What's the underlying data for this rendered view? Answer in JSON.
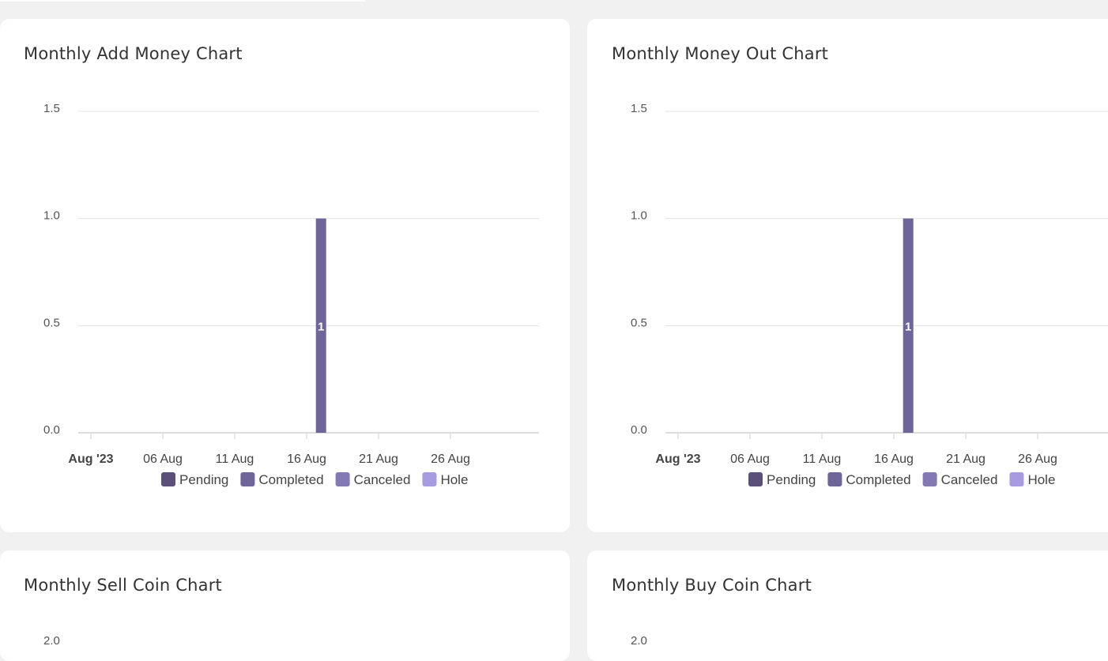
{
  "cards": [
    {
      "title": "Monthly Add Money Chart"
    },
    {
      "title": "Monthly Money Out Chart"
    },
    {
      "title": "Monthly Sell Coin Chart"
    },
    {
      "title": "Monthly Buy Coin Chart"
    }
  ],
  "legend": [
    {
      "label": "Pending",
      "color": "#5a5078"
    },
    {
      "label": "Completed",
      "color": "#6f6598"
    },
    {
      "label": "Canceled",
      "color": "#8579b4"
    },
    {
      "label": "Hole",
      "color": "#a99be0"
    }
  ],
  "chart_data": [
    {
      "type": "bar",
      "title": "Monthly Add Money Chart",
      "x_tick_labels": [
        "Aug '23",
        "06 Aug",
        "11 Aug",
        "16 Aug",
        "21 Aug",
        "26 Aug"
      ],
      "x_tick_dates": [
        "2023-08-01",
        "2023-08-06",
        "2023-08-11",
        "2023-08-16",
        "2023-08-21",
        "2023-08-26"
      ],
      "xlim": [
        "2023-08-01",
        "2023-08-31"
      ],
      "y_ticks": [
        "1.5",
        "1.0",
        "0.5",
        "0.0"
      ],
      "ylim": [
        0,
        1.5
      ],
      "stacked": true,
      "series": [
        {
          "name": "Pending",
          "points": []
        },
        {
          "name": "Completed",
          "points": [
            {
              "x": "2023-08-17",
              "y": 1,
              "label": "1"
            }
          ]
        },
        {
          "name": "Canceled",
          "points": []
        },
        {
          "name": "Hole",
          "points": []
        }
      ],
      "legend_position": "bottom",
      "grid": true
    },
    {
      "type": "bar",
      "title": "Monthly Money Out Chart",
      "x_tick_labels": [
        "Aug '23",
        "06 Aug",
        "11 Aug",
        "16 Aug",
        "21 Aug",
        "26 Aug"
      ],
      "x_tick_dates": [
        "2023-08-01",
        "2023-08-06",
        "2023-08-11",
        "2023-08-16",
        "2023-08-21",
        "2023-08-26"
      ],
      "xlim": [
        "2023-08-01",
        "2023-08-31"
      ],
      "y_ticks": [
        "1.5",
        "1.0",
        "0.5",
        "0.0"
      ],
      "ylim": [
        0,
        1.5
      ],
      "stacked": true,
      "series": [
        {
          "name": "Pending",
          "points": []
        },
        {
          "name": "Completed",
          "points": [
            {
              "x": "2023-08-17",
              "y": 1,
              "label": "1"
            }
          ]
        },
        {
          "name": "Canceled",
          "points": []
        },
        {
          "name": "Hole",
          "points": []
        }
      ],
      "legend_position": "bottom",
      "grid": true
    },
    {
      "type": "bar",
      "title": "Monthly Sell Coin Chart",
      "y_ticks": [
        "2.0"
      ],
      "note": "only top of chart visible"
    },
    {
      "type": "bar",
      "title": "Monthly Buy Coin Chart",
      "y_ticks": [
        "2.0"
      ],
      "note": "only top of chart visible"
    }
  ]
}
